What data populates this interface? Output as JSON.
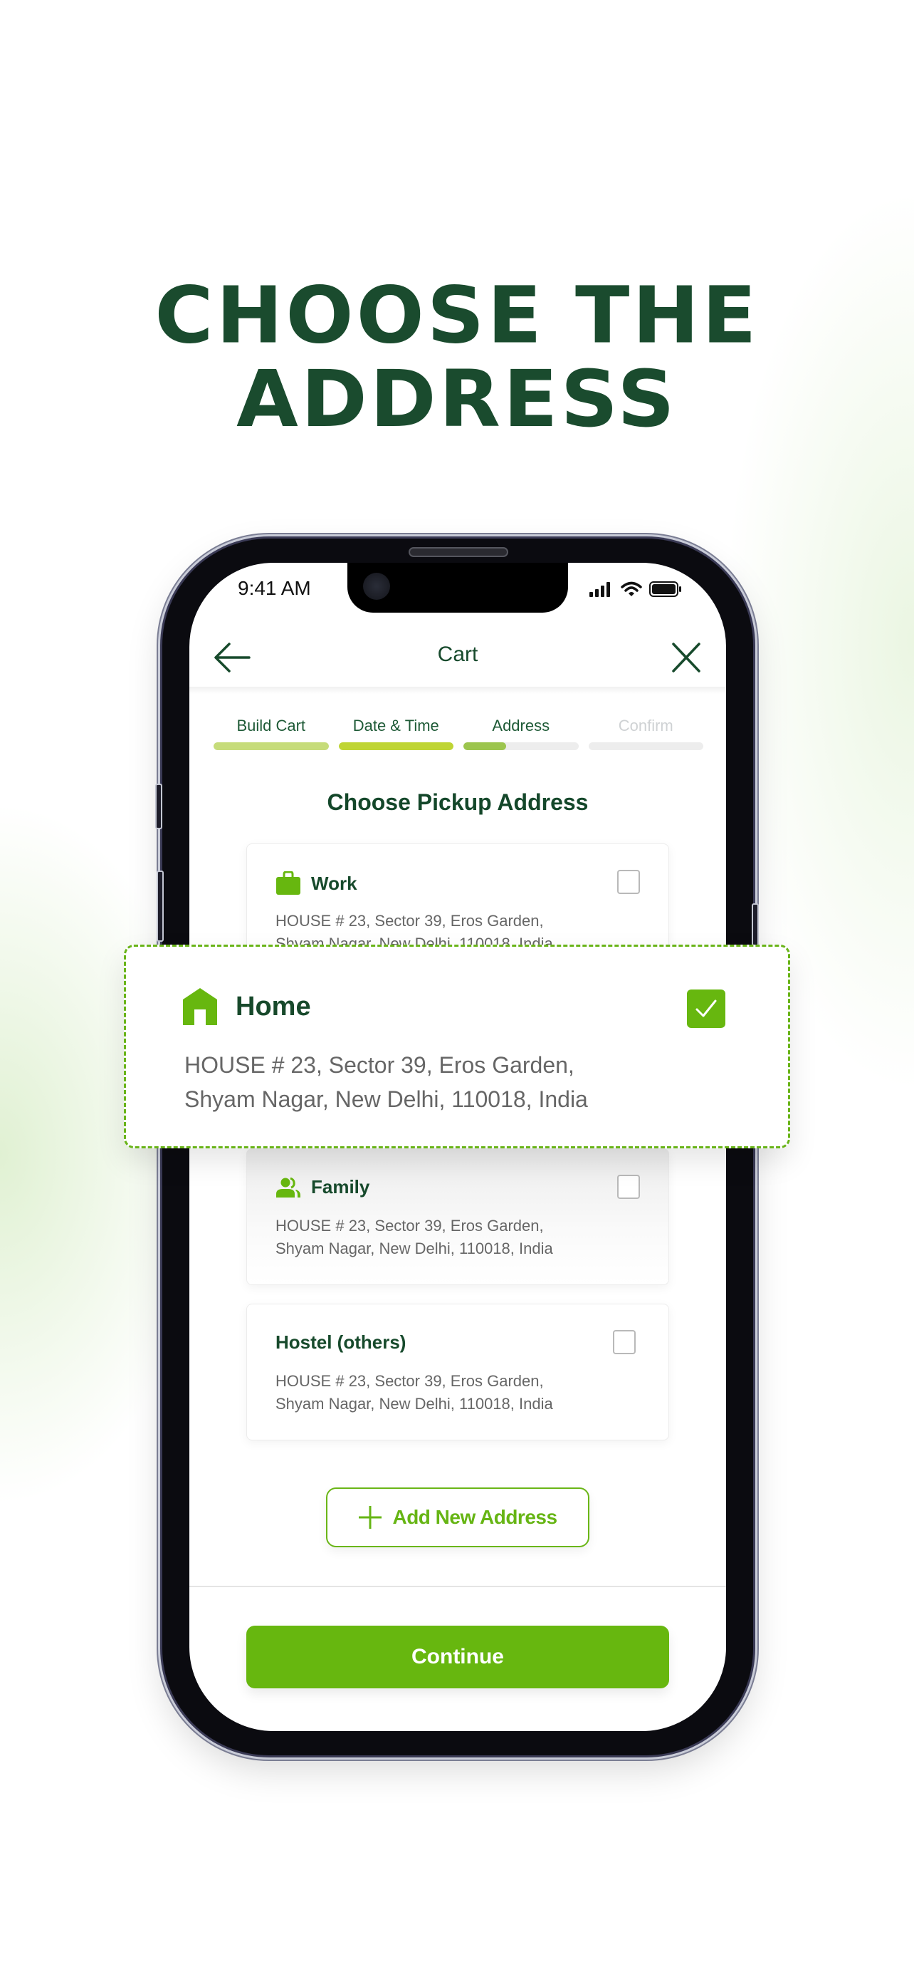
{
  "headline": {
    "line1": "CHOOSE THE",
    "line2": "ADDRESS"
  },
  "status_bar": {
    "time": "9:41 AM",
    "icons": [
      "signal-icon",
      "wifi-icon",
      "battery-icon"
    ]
  },
  "nav": {
    "title": "Cart",
    "back_icon": "arrow-left-icon",
    "close_icon": "close-icon"
  },
  "steps": [
    {
      "label": "Build Cart",
      "progress": 1.0,
      "color": "#c6dc7a",
      "state": "done"
    },
    {
      "label": "Date & Time",
      "progress": 1.0,
      "color": "#bfd534",
      "state": "done"
    },
    {
      "label": "Address",
      "progress": 0.37,
      "color": "#9cc54e",
      "state": "current"
    },
    {
      "label": "Confirm",
      "progress": 0.0,
      "color": "#ededed",
      "state": "upcoming"
    }
  ],
  "section_title": "Choose Pickup Address",
  "addresses": [
    {
      "type": "Work",
      "icon": "briefcase-icon",
      "line1": "HOUSE # 23, Sector 39, Eros Garden,",
      "line2": "Shyam Nagar, New Delhi, 110018, India",
      "selected": false
    },
    {
      "type": "Home",
      "icon": "home-icon",
      "line1": "HOUSE # 23, Sector 39, Eros Garden,",
      "line2": "Shyam Nagar, New Delhi, 110018, India",
      "selected": true
    },
    {
      "type": "Family",
      "icon": "family-icon",
      "line1": "HOUSE # 23, Sector 39, Eros Garden,",
      "line2": "Shyam Nagar, New Delhi, 110018, India",
      "selected": false
    },
    {
      "type": "Hostel (others)",
      "icon": "",
      "line1": "HOUSE # 23, Sector 39, Eros Garden,",
      "line2": "Shyam Nagar, New Delhi, 110018, India",
      "selected": false
    }
  ],
  "add_button": {
    "label": "Add New Address",
    "icon": "plus-icon"
  },
  "continue_button": {
    "label": "Continue"
  },
  "colors": {
    "brand_dark": "#1a4b2e",
    "brand_green": "#67b70f",
    "address_text": "#666666"
  }
}
